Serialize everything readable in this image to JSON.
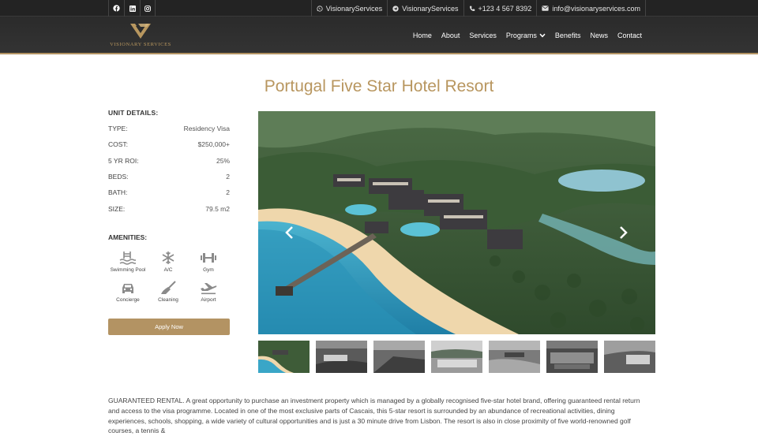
{
  "topbar": {
    "social": [
      {
        "icon": "facebook-icon"
      },
      {
        "icon": "linkedin-icon"
      },
      {
        "icon": "instagram-icon"
      }
    ],
    "whatsapp_label": "VisionaryServices",
    "telegram_label": "VisionaryServices",
    "phone": "+123 4 567 8392",
    "email": "info@visionaryservices.com"
  },
  "header": {
    "logo_text": "VISIONARY SERVICES",
    "brand_color": "#b39363",
    "nav": [
      "Home",
      "About",
      "Services",
      "Programs",
      "Benefits",
      "News",
      "Contact"
    ]
  },
  "page": {
    "title": "Portugal Five Star Hotel Resort"
  },
  "unit_details": {
    "heading": "UNIT DETAILS:",
    "rows": [
      {
        "label": "TYPE:",
        "value": "Residency Visa"
      },
      {
        "label": "COST:",
        "value": "$250,000+"
      },
      {
        "label": "5 YR ROI:",
        "value": "25%"
      },
      {
        "label": "BEDS:",
        "value": "2"
      },
      {
        "label": "BATH:",
        "value": "2"
      },
      {
        "label": "SIZE:",
        "value": "79.5 m2"
      }
    ]
  },
  "amenities": {
    "heading": "AMENITIES:",
    "items": [
      {
        "label": "Swimming Pool",
        "icon": "swimming-pool-icon"
      },
      {
        "label": "A/C",
        "icon": "snowflake-icon"
      },
      {
        "label": "Gym",
        "icon": "dumbbell-icon"
      },
      {
        "label": "Concierge",
        "icon": "car-icon"
      },
      {
        "label": "Cleaning",
        "icon": "broom-icon"
      },
      {
        "label": "Airport",
        "icon": "plane-icon"
      }
    ]
  },
  "apply_label": "Apply Now",
  "gallery": {
    "thumb_count_visible": 7
  },
  "description": "GUARANTEED RENTAL. A great opportunity to purchase an investment property which is managed by a globally recognised five-star hotel brand, offering guaranteed rental return and access to the visa programme. Located in one of the most exclusive parts of Cascais, this 5-star resort is surrounded by an abundance of recreational activities, dining experiences, schools, shopping, a wide variety of cultural opportunities and is just a 30 minute drive from Lisbon. The resort is also in close proximity of five world-renowned golf courses, a tennis &"
}
